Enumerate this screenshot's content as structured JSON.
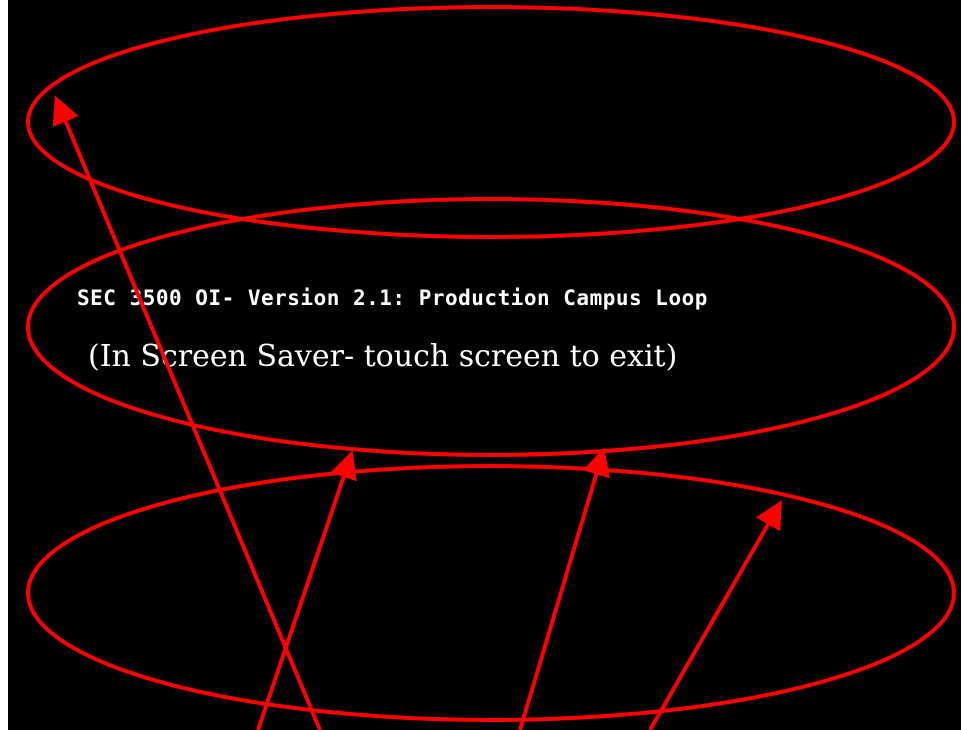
{
  "screen": {
    "title": "SEC 3500 OI- Version 2.1: Production Campus Loop",
    "hint": "(In Screen Saver- touch screen to exit)"
  },
  "colors": {
    "background": "#000000",
    "text": "#ffffff",
    "annotation": "#ff0000"
  }
}
